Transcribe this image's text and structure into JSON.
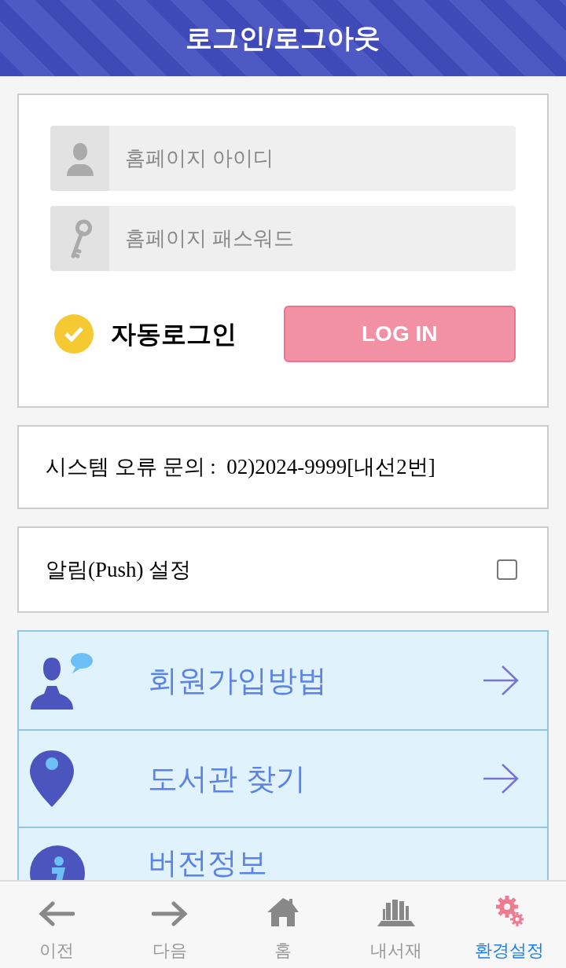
{
  "header": {
    "title": "로그인/로그아웃"
  },
  "login": {
    "id_field": {
      "placeholder": "홈페이지 아이디"
    },
    "password_field": {
      "placeholder": "홈페이지 패스워드"
    },
    "auto_login": {
      "label": "자동로그인",
      "checked": true
    },
    "button": "LOG IN"
  },
  "support": {
    "text": "시스템 오류 문의 :  02)2024-9999[내선2번]"
  },
  "push": {
    "label": "알림(Push) 설정",
    "checked": false
  },
  "menu": [
    {
      "kind": "person",
      "label": "회원가입방법",
      "arrow": true
    },
    {
      "kind": "pin",
      "label": "도서관 찾기",
      "arrow": true
    },
    {
      "kind": "info",
      "label": "버전정보",
      "arrow": false
    }
  ],
  "nav": [
    {
      "kind": "back",
      "label": "이전",
      "selected": false
    },
    {
      "kind": "forward",
      "label": "다음",
      "selected": false
    },
    {
      "kind": "home",
      "label": "홈",
      "selected": false
    },
    {
      "kind": "books",
      "label": "내서재",
      "selected": false
    },
    {
      "kind": "settings",
      "label": "환경설정",
      "selected": true
    }
  ]
}
